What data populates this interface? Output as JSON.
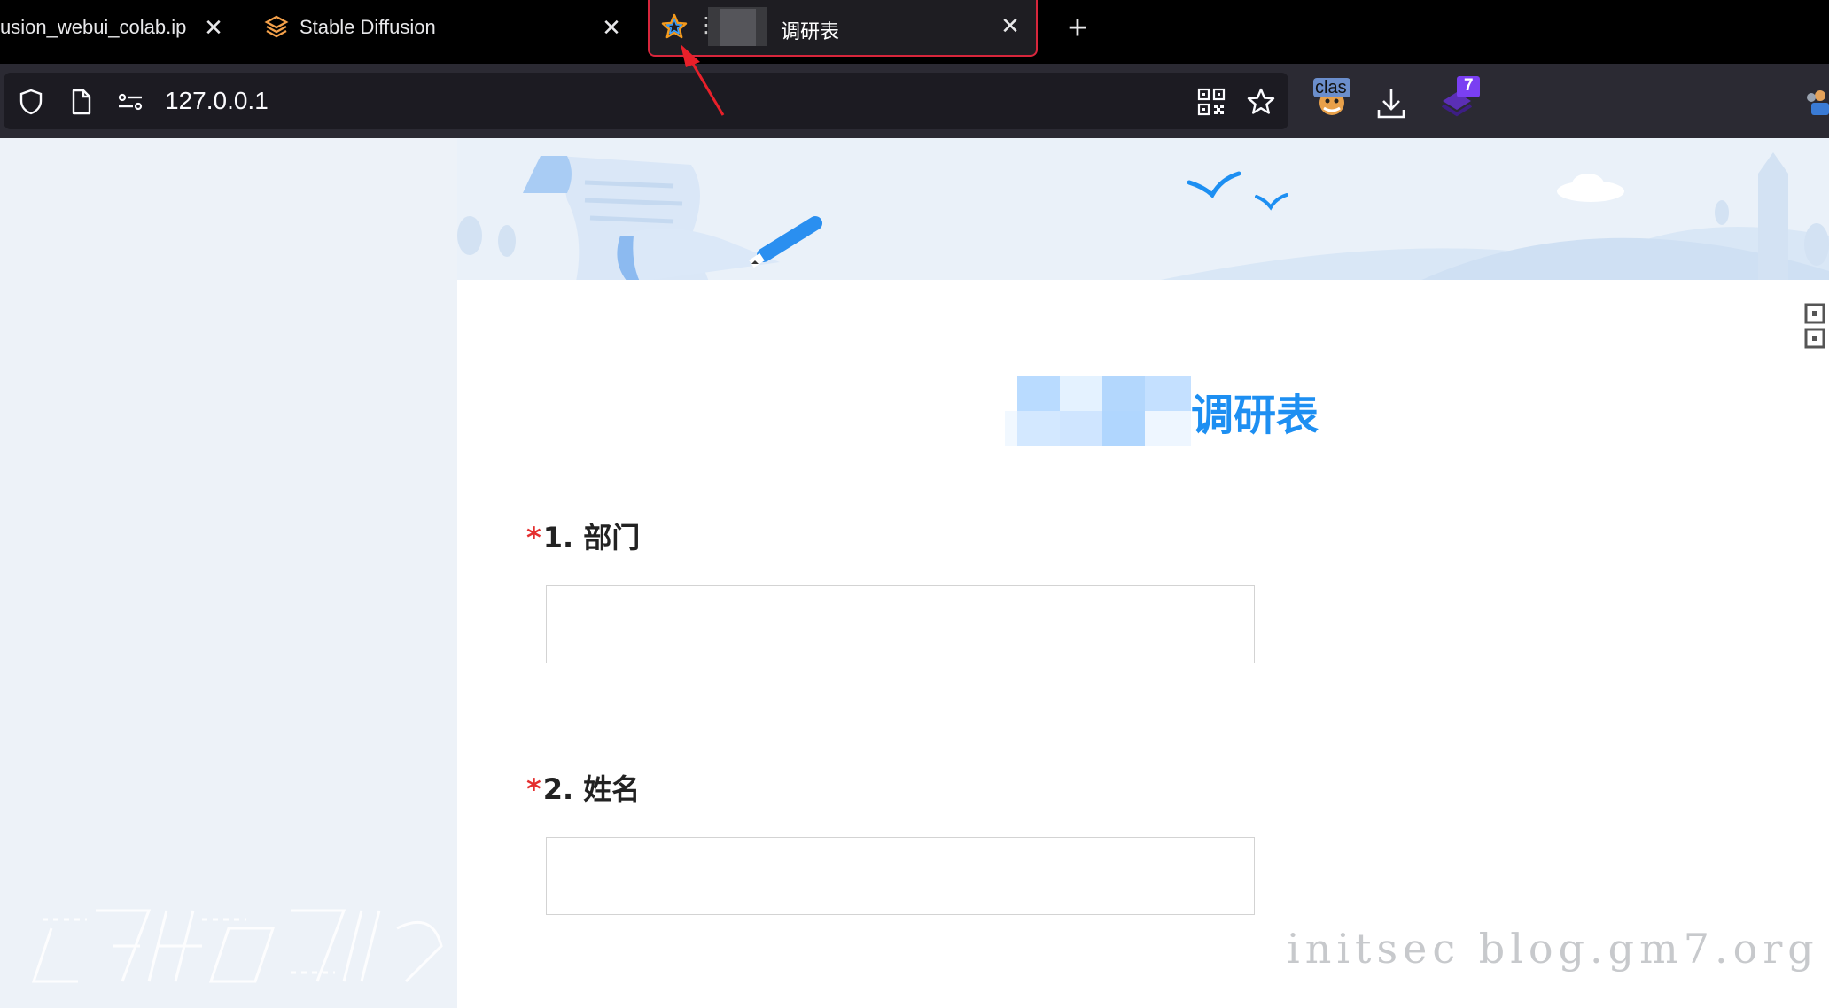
{
  "browser": {
    "tabs": [
      {
        "label": "usion_webui_colab.ip",
        "icon": "document-icon"
      },
      {
        "label": "Stable Diffusion",
        "icon": "stable-diffusion-logo-icon"
      },
      {
        "label": "调研表",
        "icon": "star-icon",
        "active": true
      }
    ],
    "tab_close_glyph": "✕",
    "new_tab_glyph": "+",
    "url": "127.0.0.1",
    "extensions": {
      "clash_badge": "clas",
      "notification_badge": "7"
    }
  },
  "form": {
    "title": "调研表",
    "questions": [
      {
        "required_mark": "*",
        "label": "1. 部门",
        "value": ""
      },
      {
        "required_mark": "*",
        "label": "2. 姓名",
        "value": ""
      }
    ]
  },
  "watermark": "initsec blog.gm7.org",
  "colors": {
    "tab_active_border": "#d8263c",
    "title_blue": "#1d8ff2",
    "required_red": "#e42e2e",
    "annotation_arrow": "#e8202a"
  }
}
